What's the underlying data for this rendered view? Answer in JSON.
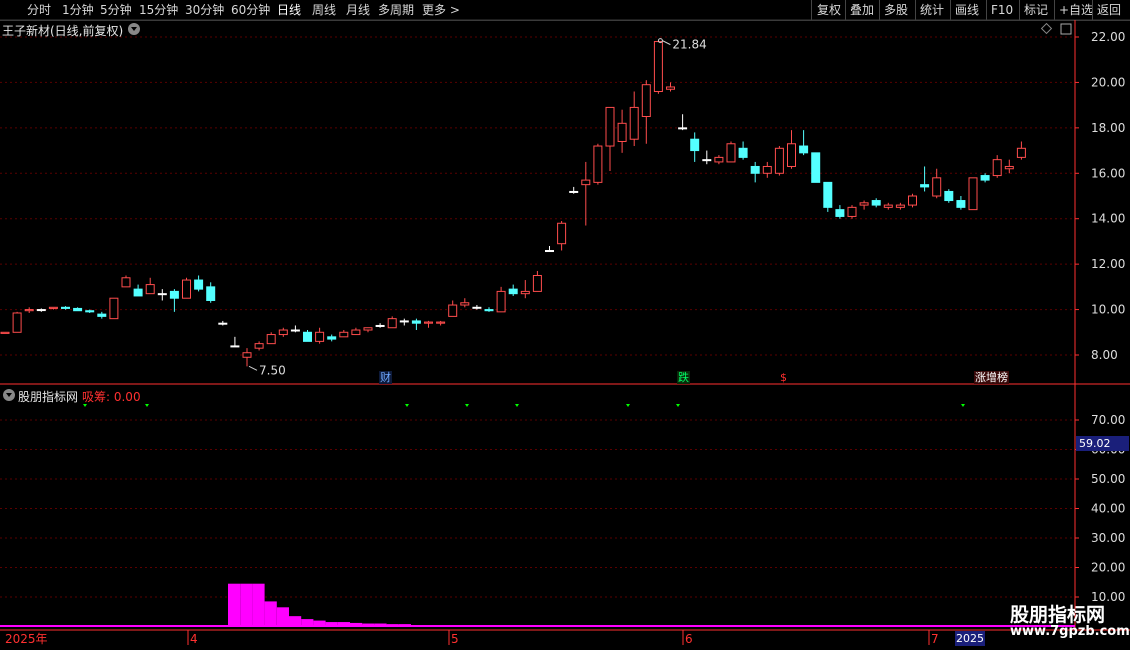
{
  "toolbar": {
    "left_items": [
      "分时",
      "1分钟",
      "5分钟",
      "15分钟",
      "30分钟",
      "60分钟",
      "日线",
      "周线",
      "月线",
      "多周期",
      "更多 >"
    ],
    "active_item": "日线",
    "right_items": [
      "复权",
      "叠加",
      "多股",
      "统计",
      "画线",
      "F10",
      "标记",
      "+自选",
      "返回"
    ]
  },
  "main_title": "王子新材(日线,前复权)",
  "indicator": {
    "name": "股朋指标网",
    "series_label": "吸筹: 0.00",
    "current_value_box": "59.02"
  },
  "annotations": {
    "high_label": "21.84",
    "low_label": "7.50",
    "tag_cai": "财",
    "tag_die": "跌",
    "tag_s": "$",
    "tag_zhang": "涨增榜"
  },
  "x_axis": {
    "year_label": "2025年",
    "months": [
      "4",
      "5",
      "6",
      "7"
    ],
    "year_box": "2025"
  },
  "watermark": {
    "text": "股朋指标网",
    "url": "www.7gpzb.com"
  },
  "colors": {
    "up": "#ff4d4d",
    "down": "#54ffff",
    "flat": "#ffffff",
    "grid": "#5a0000",
    "axis": "#ff3030",
    "bar": "#ff00ff",
    "marker": "#00ff00",
    "toolbar_active": "#ffffff"
  },
  "chart_data": [
    {
      "type": "candlestick",
      "title": "王子新材(日线,前复权)",
      "y_axis_ticks": [
        "8.00",
        "10.00",
        "12.00",
        "14.00",
        "16.00",
        "18.00",
        "20.00",
        "22.00"
      ],
      "ylim": [
        7.0,
        22.2
      ],
      "candles": [
        [
          8.95,
          9.0,
          8.95,
          9.0
        ],
        [
          9.0,
          9.9,
          9.0,
          9.85
        ],
        [
          9.95,
          10.1,
          9.85,
          10.0
        ],
        [
          10.0,
          10.05,
          9.9,
          10.0
        ],
        [
          10.05,
          10.1,
          10.0,
          10.1
        ],
        [
          10.1,
          10.15,
          10.0,
          10.05
        ],
        [
          10.05,
          10.1,
          9.95,
          9.95
        ],
        [
          9.95,
          10.0,
          9.85,
          9.9
        ],
        [
          9.8,
          9.9,
          9.6,
          9.7
        ],
        [
          9.6,
          10.5,
          9.6,
          10.5
        ],
        [
          11.0,
          11.5,
          11.0,
          11.4
        ],
        [
          10.9,
          11.1,
          10.6,
          10.6
        ],
        [
          10.7,
          11.4,
          10.7,
          11.1
        ],
        [
          10.7,
          10.9,
          10.4,
          10.7
        ],
        [
          10.8,
          10.9,
          9.9,
          10.5
        ],
        [
          10.5,
          11.4,
          10.5,
          11.3
        ],
        [
          11.3,
          11.5,
          10.8,
          10.9
        ],
        [
          11.0,
          11.2,
          10.3,
          10.4
        ],
        [
          9.4,
          9.5,
          9.3,
          9.4
        ],
        [
          8.4,
          8.8,
          8.4,
          8.4
        ],
        [
          7.9,
          8.3,
          7.5,
          8.1
        ],
        [
          8.3,
          8.6,
          8.2,
          8.5
        ],
        [
          8.5,
          9.0,
          8.5,
          8.9
        ],
        [
          8.9,
          9.2,
          8.8,
          9.1
        ],
        [
          9.1,
          9.3,
          9.0,
          9.1
        ],
        [
          9.0,
          9.1,
          8.6,
          8.6
        ],
        [
          8.6,
          9.2,
          8.5,
          9.0
        ],
        [
          8.8,
          8.9,
          8.6,
          8.7
        ],
        [
          8.8,
          9.1,
          8.8,
          9.0
        ],
        [
          8.9,
          9.2,
          8.9,
          9.1
        ],
        [
          9.1,
          9.2,
          9.0,
          9.2
        ],
        [
          9.3,
          9.4,
          9.2,
          9.3
        ],
        [
          9.2,
          9.7,
          9.2,
          9.6
        ],
        [
          9.5,
          9.6,
          9.3,
          9.5
        ],
        [
          9.5,
          9.6,
          9.1,
          9.4
        ],
        [
          9.4,
          9.5,
          9.2,
          9.45
        ],
        [
          9.4,
          9.5,
          9.3,
          9.45
        ],
        [
          9.7,
          10.4,
          9.7,
          10.2
        ],
        [
          10.2,
          10.5,
          10.1,
          10.3
        ],
        [
          10.1,
          10.2,
          10.0,
          10.1
        ],
        [
          10.0,
          10.1,
          9.9,
          9.95
        ],
        [
          9.9,
          11.0,
          9.9,
          10.8
        ],
        [
          10.9,
          11.1,
          10.6,
          10.7
        ],
        [
          10.7,
          11.3,
          10.5,
          10.8
        ],
        [
          10.8,
          11.7,
          10.8,
          11.5
        ],
        [
          12.6,
          12.8,
          12.6,
          12.6
        ],
        [
          12.9,
          13.9,
          12.6,
          13.8
        ],
        [
          15.2,
          15.4,
          15.1,
          15.2
        ],
        [
          15.5,
          16.5,
          13.7,
          15.7
        ],
        [
          15.6,
          17.3,
          15.5,
          17.2
        ],
        [
          17.2,
          18.9,
          16.1,
          18.9
        ],
        [
          17.4,
          18.8,
          16.9,
          18.2
        ],
        [
          17.5,
          19.6,
          17.2,
          18.9
        ],
        [
          18.5,
          20.1,
          17.3,
          19.9
        ],
        [
          19.6,
          21.84,
          19.5,
          21.8
        ],
        [
          19.7,
          20.0,
          19.6,
          19.8
        ],
        [
          18.0,
          18.6,
          17.9,
          18.0
        ],
        [
          17.5,
          17.8,
          16.5,
          17.0
        ],
        [
          16.6,
          17.0,
          16.4,
          16.6
        ],
        [
          16.5,
          16.8,
          16.4,
          16.7
        ],
        [
          16.5,
          17.4,
          16.5,
          17.3
        ],
        [
          17.1,
          17.4,
          16.6,
          16.7
        ],
        [
          16.3,
          16.5,
          15.6,
          16.0
        ],
        [
          16.0,
          16.5,
          15.8,
          16.3
        ],
        [
          16.0,
          17.2,
          15.9,
          17.1
        ],
        [
          16.3,
          17.9,
          16.2,
          17.3
        ],
        [
          17.2,
          17.9,
          16.8,
          16.9
        ],
        [
          16.9,
          16.9,
          15.6,
          15.6
        ],
        [
          15.6,
          15.6,
          14.3,
          14.5
        ],
        [
          14.4,
          14.6,
          14.0,
          14.1
        ],
        [
          14.1,
          14.6,
          14.0,
          14.5
        ],
        [
          14.6,
          14.8,
          14.4,
          14.7
        ],
        [
          14.8,
          14.9,
          14.5,
          14.6
        ],
        [
          14.5,
          14.7,
          14.4,
          14.6
        ],
        [
          14.5,
          14.7,
          14.4,
          14.6
        ],
        [
          14.6,
          15.1,
          14.5,
          15.0
        ],
        [
          15.5,
          16.3,
          15.2,
          15.4
        ],
        [
          15.0,
          16.2,
          14.9,
          15.8
        ],
        [
          15.2,
          15.3,
          14.7,
          14.8
        ],
        [
          14.8,
          15.0,
          14.4,
          14.5
        ],
        [
          14.4,
          15.8,
          14.4,
          15.8
        ],
        [
          15.9,
          16.0,
          15.6,
          15.7
        ],
        [
          15.9,
          16.8,
          15.8,
          16.6
        ],
        [
          16.2,
          16.6,
          16.0,
          16.3
        ],
        [
          16.7,
          17.4,
          16.6,
          17.1
        ]
      ]
    },
    {
      "type": "bar",
      "series": [
        {
          "name": "吸筹",
          "values": [
            14,
            14,
            14,
            8,
            6,
            3,
            2,
            1.5,
            1,
            1,
            0.7,
            0.5,
            0.5,
            0.3,
            0.3
          ]
        }
      ],
      "signal_markers_x": [
        85,
        147,
        407,
        467,
        517,
        628,
        678,
        963
      ],
      "y_axis_ticks": [
        "10.00",
        "20.00",
        "30.00",
        "40.00",
        "50.00",
        "60.00",
        "70.00"
      ],
      "ylim": [
        10,
        81
      ]
    }
  ]
}
